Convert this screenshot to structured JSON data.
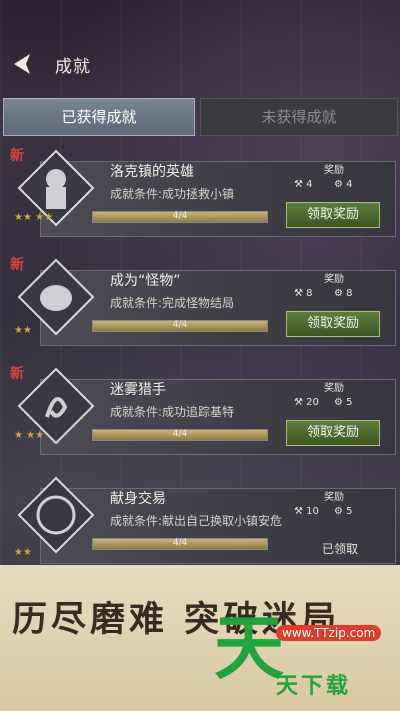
{
  "header": {
    "title": "成就"
  },
  "tabs": [
    {
      "label": "已获得成就"
    },
    {
      "label": "未获得成就"
    }
  ],
  "new_label": "新",
  "reward_label": "奖励",
  "claim_label": "领取奖励",
  "cards": [
    {
      "title": "洛克镇的英雄",
      "condition": "成就条件:成功拯救小镇",
      "progress": "4/4",
      "progress_fraction": 1.0,
      "reward_a": "4",
      "reward_b": "4",
      "stars": "★★ ★★",
      "is_new": true
    },
    {
      "title": "成为“怪物”",
      "condition": "成就条件:完成怪物结局",
      "progress": "4/4",
      "progress_fraction": 1.0,
      "reward_a": "8",
      "reward_b": "8",
      "stars": "★★",
      "is_new": true
    },
    {
      "title": "迷雾猎手",
      "condition": "成就条件:成功追踪基特",
      "progress": "4/4",
      "progress_fraction": 1.0,
      "reward_a": "20",
      "reward_b": "5",
      "stars": "★ ★★",
      "is_new": true
    },
    {
      "title": "献身交易",
      "condition": "成就条件:献出自己换取小镇安危",
      "progress": "4/4",
      "progress_fraction": 1.0,
      "reward_a": "10",
      "reward_b": "5",
      "stars": "★★",
      "is_new": false
    }
  ],
  "claimed_partial": "已领取",
  "banner": {
    "text": "历尽磨难 突破迷局",
    "logo_big": "天",
    "logo_small": "天下载",
    "logo_url": "www.TTzip.com"
  }
}
